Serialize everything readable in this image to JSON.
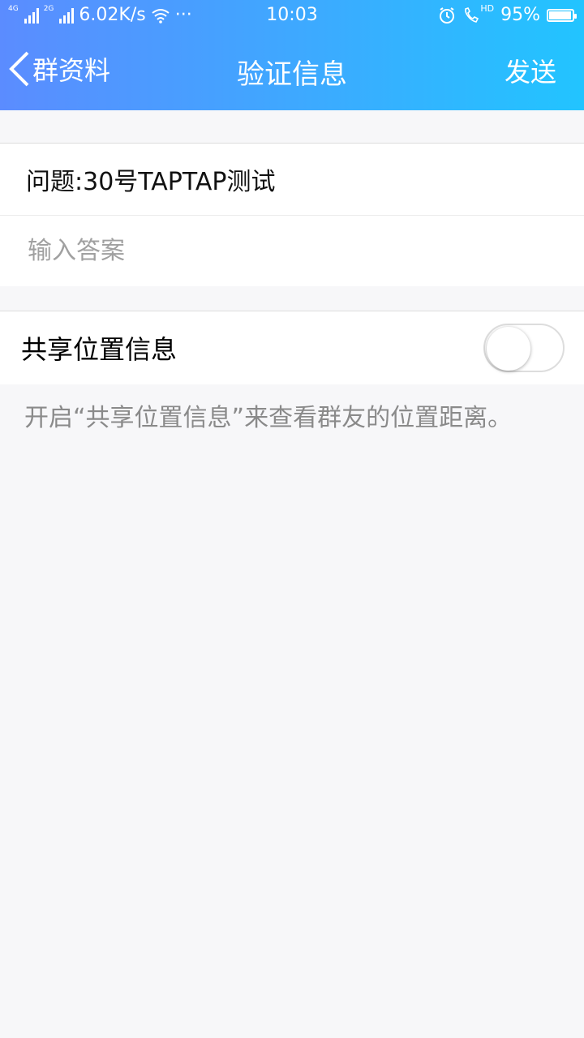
{
  "statusbar": {
    "net1": "4G",
    "net2": "2G",
    "speed": "6.02K/s",
    "dots": "···",
    "time": "10:03",
    "hd": "HD",
    "battery": "95%",
    "battery_level": 0.95
  },
  "navbar": {
    "back_label": "群资料",
    "title": "验证信息",
    "send_label": "发送"
  },
  "form": {
    "question": "问题:30号TAPTAP测试",
    "answer_placeholder": "输入答案",
    "answer_value": ""
  },
  "location": {
    "label": "共享位置信息",
    "enabled": false,
    "hint": "开启“共享位置信息”来查看群友的位置距离。"
  },
  "colors": {
    "header_start": "#5b8cff",
    "header_end": "#22c4ff",
    "background": "#f7f7f9"
  }
}
